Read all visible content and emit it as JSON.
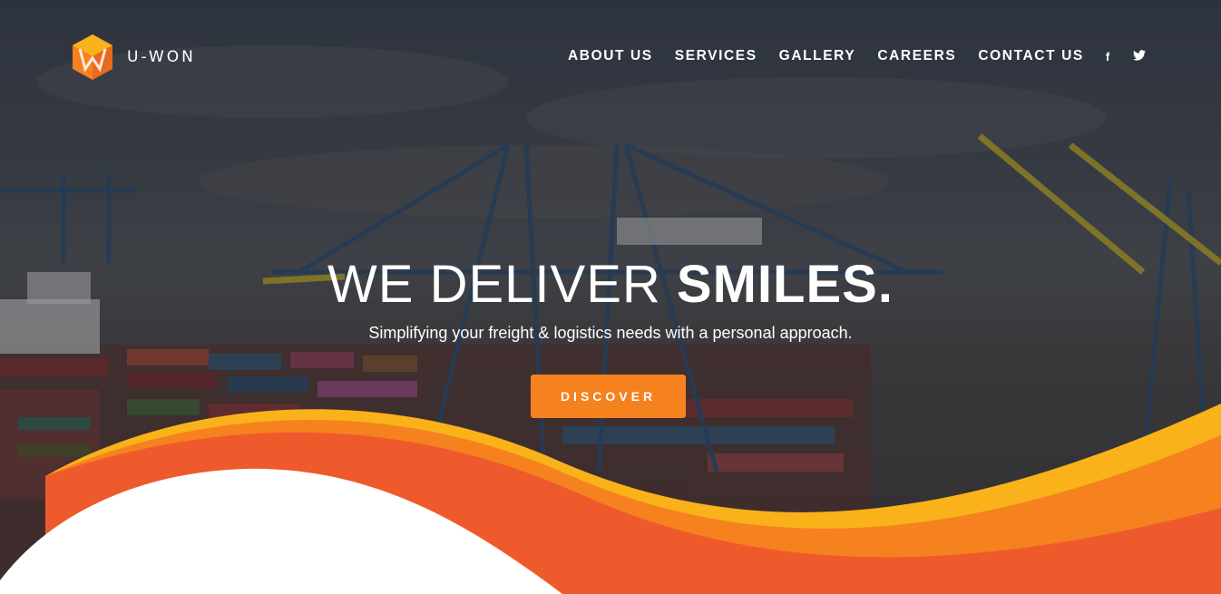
{
  "brand": {
    "name": "U-WON",
    "colors": {
      "orange": "#f5821f",
      "yellow": "#f9b21a",
      "red": "#ef5a2c"
    }
  },
  "nav": {
    "items": [
      {
        "label": "ABOUT US"
      },
      {
        "label": "SERVICES"
      },
      {
        "label": "GALLERY"
      },
      {
        "label": "CAREERS"
      },
      {
        "label": "CONTACT US"
      }
    ]
  },
  "social": {
    "facebook": {
      "icon": "facebook-icon",
      "glyph": "f"
    },
    "twitter": {
      "icon": "twitter-icon",
      "glyph": "🐦"
    }
  },
  "hero": {
    "headline_light": "WE DELIVER ",
    "headline_bold": "SMILES.",
    "subheadline": "Simplifying your freight & logistics needs with a personal approach.",
    "cta_label": "DISCOVER"
  }
}
